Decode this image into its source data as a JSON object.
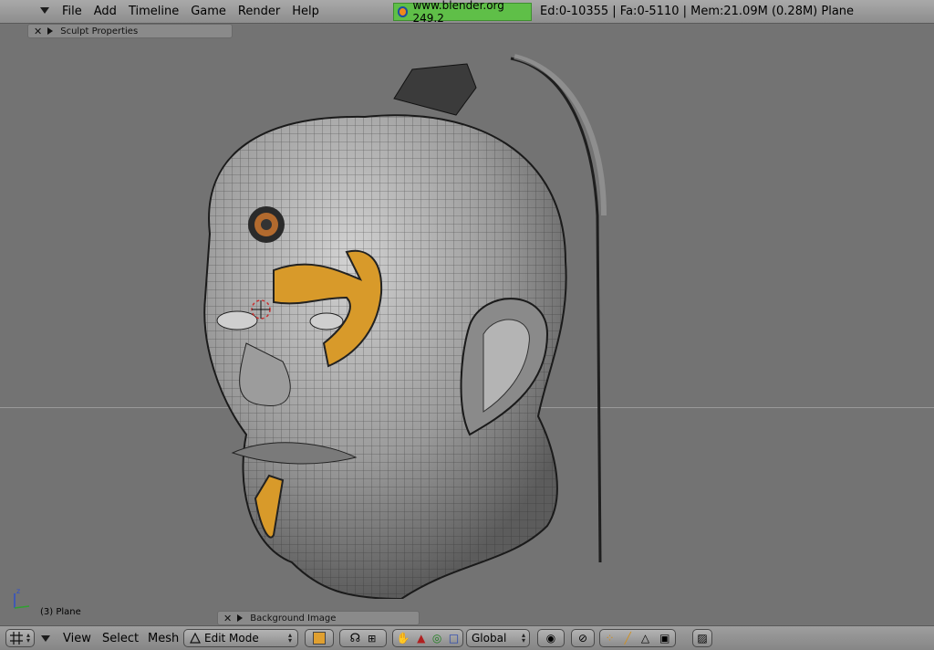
{
  "menubar": {
    "items": [
      "File",
      "Add",
      "Timeline",
      "Game",
      "Render",
      "Help"
    ],
    "version": "www.blender.org 249.2",
    "stats": "Ed:0-10355 | Fa:0-5110 | Mem:21.09M (0.28M) Plane"
  },
  "viewport": {
    "sculpt_panel_title": "Sculpt Properties",
    "background_panel_title": "Background Image",
    "object_label": "(3) Plane",
    "axis_label": "z"
  },
  "header": {
    "menus": [
      "View",
      "Select",
      "Mesh"
    ],
    "mode": "Edit Mode",
    "orientation": "Global"
  },
  "colors": {
    "version_bg": "#5fbf48",
    "viewport_bg": "#737373",
    "accent_paint": "#d89a2a"
  }
}
